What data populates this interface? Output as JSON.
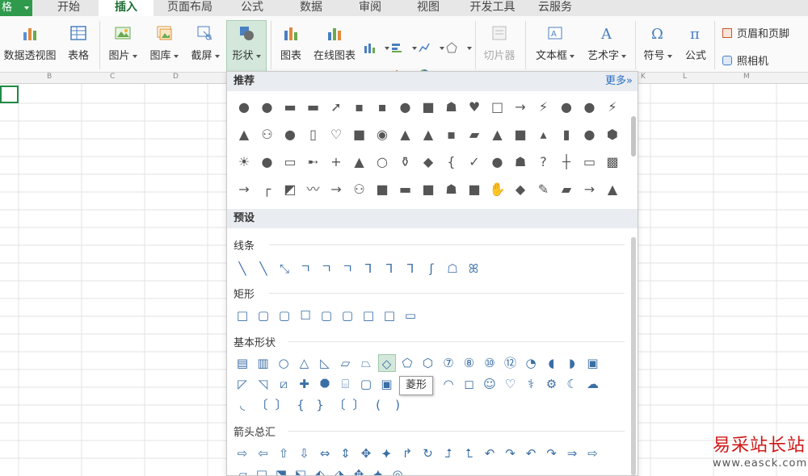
{
  "tabs": {
    "file_label": "格",
    "items": [
      "开始",
      "插入",
      "页面布局",
      "公式",
      "数据",
      "审阅",
      "视图",
      "开发工具",
      "云服务"
    ],
    "active": "插入"
  },
  "ribbon": {
    "pivot_table": "数据透视图",
    "table": "表格",
    "picture": "图片",
    "gallery": "图库",
    "screenshot": "截屏",
    "shapes": "形状",
    "chart": "图表",
    "online_chart": "在线图表",
    "slicer": "切片器",
    "textbox": "文本框",
    "wordart": "艺术字",
    "symbol": "符号",
    "formula": "公式",
    "header_footer": "页眉和页脚",
    "camera": "照相机"
  },
  "columns": [
    "B",
    "C",
    "D",
    "K",
    "L",
    "M"
  ],
  "panel": {
    "recommend_title": "推荐",
    "more_label": "更多»",
    "preset_title": "预设",
    "lines_label": "线条",
    "rect_label": "矩形",
    "basic_label": "基本形状",
    "arrows_label": "箭头总汇",
    "tooltip": "菱形",
    "recommend_rows": [
      [
        "●",
        "●",
        "▬",
        "▬",
        "➚",
        "▪",
        "▪",
        "●",
        "■",
        "☗",
        "♥",
        "□",
        "→",
        "⚡",
        "●",
        "●",
        "⚡"
      ],
      [
        "▲",
        "⚇",
        "●",
        "▯",
        "♡",
        "■",
        "◉",
        "▲",
        "▲",
        "▪",
        "▰",
        "▲",
        "■",
        "▴",
        "▮",
        "●",
        "⬢"
      ],
      [
        "☀",
        "●",
        "▭",
        "➸",
        "+",
        "▲",
        "○",
        "⚱",
        "◆",
        "{",
        "✓",
        "●",
        "☗",
        "?",
        "┼",
        "▭",
        "▩"
      ],
      [
        "→",
        "┌",
        "◩",
        "〰",
        "→",
        "⚇",
        "■",
        "▬",
        "■",
        "☗",
        "■",
        "✋",
        "◆",
        "✎",
        "▰",
        "→",
        "▲"
      ]
    ],
    "lines_shapes": [
      "╲",
      "╲",
      "⤡",
      "ㄱ",
      "ㄱ",
      "ㄱ",
      "Ꞁ",
      "Ꞁ",
      "Ꞁ",
      "ʃ",
      "☖",
      "ꕤ"
    ],
    "rect_shapes": [
      "□",
      "▢",
      "▢",
      "☐",
      "▢",
      "▢",
      "□",
      "□",
      "▭"
    ],
    "basic_row1": [
      "▤",
      "▥",
      "○",
      "△",
      "◺",
      "▱",
      "⏢",
      "◇",
      "⬠",
      "⬡",
      "⑦",
      "⑧",
      "⑩",
      "⑫",
      "◔",
      "◖",
      "◗",
      "▣"
    ],
    "basic_row2": [
      "◸",
      "◹",
      "⧄",
      "✚",
      "⯃",
      "⌸",
      "▢",
      "▣",
      "",
      "",
      "◠",
      "◻",
      "☺",
      "♡",
      "⚕",
      "⚙",
      "☾",
      "☁"
    ],
    "basic_row3": [
      "◟",
      "〔",
      "〕",
      "{",
      "}",
      "〔",
      "〕",
      "(",
      ")"
    ],
    "arrow_row1": [
      "⇨",
      "⇦",
      "⇧",
      "⇩",
      "⇔",
      "⇕",
      "✥",
      "⯌",
      "↱",
      "↻",
      "⮥",
      "⮤",
      "↶",
      "↷",
      "↶",
      "↷",
      "⇒",
      "⇨"
    ],
    "arrow_row2": [
      "▱",
      "⬓",
      "⬔",
      "⬕",
      "⬖",
      "⬗",
      "✥",
      "⯌",
      "◎"
    ]
  },
  "watermark": {
    "title": "易采站长站",
    "url": "www.easck.com"
  }
}
